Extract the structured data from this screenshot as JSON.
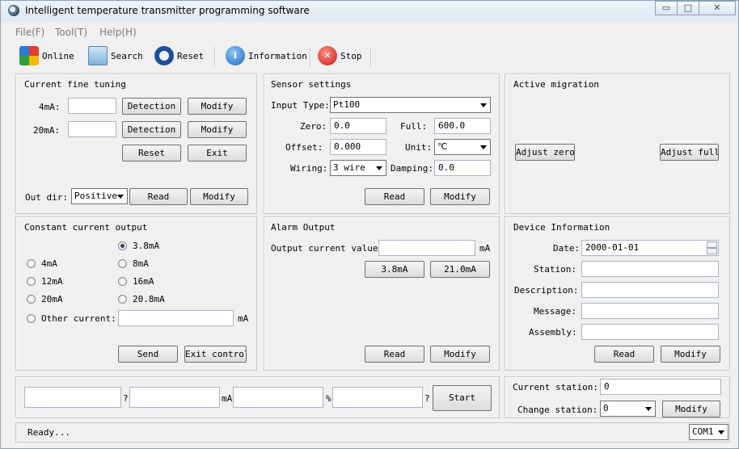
{
  "window": {
    "title": "Intelligent temperature transmitter programming software",
    "min_glyph": "▭",
    "max_glyph": "□",
    "close_glyph": "✕"
  },
  "menu": {
    "file": "File(F)",
    "tool": "Tool(T)",
    "help": "Help(H)"
  },
  "toolbar": {
    "online": "Online",
    "search": "Search",
    "reset": "Reset",
    "information": "Information",
    "stop": "Stop"
  },
  "current_fine_tuning": {
    "title": "Current fine tuning",
    "label_4ma": "4mA:",
    "label_20ma": "20mA:",
    "value_4ma": "",
    "value_20ma": "",
    "detection": "Detection",
    "modify": "Modify",
    "reset": "Reset",
    "exit": "Exit",
    "out_dir_label": "Out dir:",
    "out_dir_value": "Positive",
    "read": "Read"
  },
  "sensor_settings": {
    "title": "Sensor settings",
    "input_type_label": "Input Type:",
    "input_type_value": "Pt100",
    "zero_label": "Zero:",
    "zero_value": "0.0",
    "full_label": "Full:",
    "full_value": "600.0",
    "offset_label": "Offset:",
    "offset_value": "0.000",
    "unit_label": "Unit:",
    "unit_value": "℃",
    "wiring_label": "Wiring:",
    "wiring_value": "3 wire",
    "damping_label": "Damping:",
    "damping_value": "0.0",
    "read": "Read",
    "modify": "Modify"
  },
  "active_migration": {
    "title": "Active migration",
    "adjust_zero": "Adjust zero",
    "adjust_full": "Adjust full"
  },
  "constant_current_output": {
    "title": "Constant current output",
    "options": {
      "o38": "3.8mA",
      "o4": "4mA",
      "o8": "8mA",
      "o12": "12mA",
      "o16": "16mA",
      "o20": "20mA",
      "o208": "20.8mA",
      "other": "Other current:"
    },
    "selected": "3.8mA",
    "other_value": "",
    "unit": "mA",
    "send": "Send",
    "exit_control": "Exit control"
  },
  "alarm_output": {
    "title": "Alarm Output",
    "output_label": "Output current value:",
    "output_value": "",
    "unit": "mA",
    "btn_low": "3.8mA",
    "btn_high": "21.0mA",
    "read": "Read",
    "modify": "Modify"
  },
  "device_information": {
    "title": "Device Information",
    "date_label": "Date:",
    "date_value": "2000-01-01",
    "station_label": "Station:",
    "station_value": "",
    "description_label": "Description:",
    "description_value": "",
    "message_label": "Message:",
    "message_value": "",
    "assembly_label": "Assembly:",
    "assembly_value": "",
    "read": "Read",
    "modify": "Modify"
  },
  "measure": {
    "field1": "",
    "q1": "?",
    "field2": "",
    "unit_ma": "mA",
    "field3": "",
    "unit_pct": "%",
    "field4": "",
    "q2": "?",
    "start": "Start"
  },
  "station": {
    "current_label": "Current station:",
    "current_value": "0",
    "change_label": "Change station:",
    "change_value": "0",
    "modify": "Modify"
  },
  "status": {
    "text": "Ready...",
    "port": "COM1"
  }
}
